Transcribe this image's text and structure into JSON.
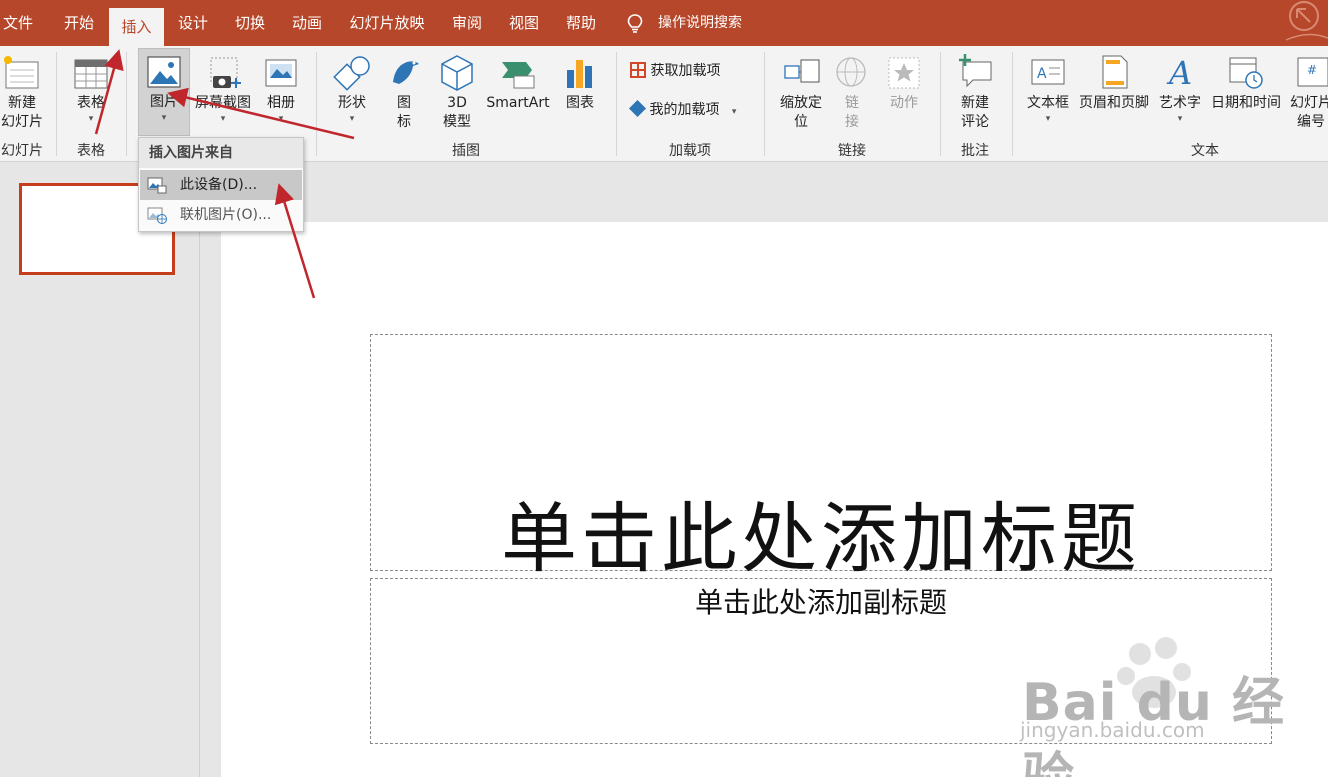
{
  "tabs": [
    "文件",
    "开始",
    "插入",
    "设计",
    "切换",
    "动画",
    "幻灯片放映",
    "审阅",
    "视图",
    "帮助"
  ],
  "active_tab": "插入",
  "tell_me": "操作说明搜索",
  "ribbon": {
    "new_slide": "新建\n幻灯片",
    "table": "表格",
    "pictures": "图片",
    "screenshot": "屏幕截图",
    "album": "相册",
    "shapes": "形状",
    "icons": "图\n标",
    "model3d": "3D\n模型",
    "smartart": "SmartArt",
    "chart": "图表",
    "get_addins": "获取加载项",
    "my_addins": "我的加载项",
    "zoom": "缩放定\n位",
    "link": "链\n接",
    "action": "动作",
    "new_comment": "新建\n评论",
    "textbox": "文本框",
    "header_footer": "页眉和页脚",
    "wordart": "艺术字",
    "datetime": "日期和时间",
    "slide_number": "幻灯片\n编号"
  },
  "groups": {
    "slides": "幻灯片",
    "tables": "表格",
    "illustrations": "插图",
    "addins": "加载项",
    "links": "链接",
    "comments": "批注",
    "text": "文本"
  },
  "menu": {
    "header": "插入图片来自",
    "this_device": "此设备(D)...",
    "online": "联机图片(O)..."
  },
  "slide": {
    "title_placeholder": "单击此处添加标题",
    "subtitle_placeholder": "单击此处添加副标题"
  },
  "watermark": {
    "brand": "Bai du 经验",
    "url": "jingyan.baidu.com"
  },
  "colors": {
    "accent": "#b7472a",
    "arrow": "#c0272d",
    "selection": "#c43e1c"
  }
}
